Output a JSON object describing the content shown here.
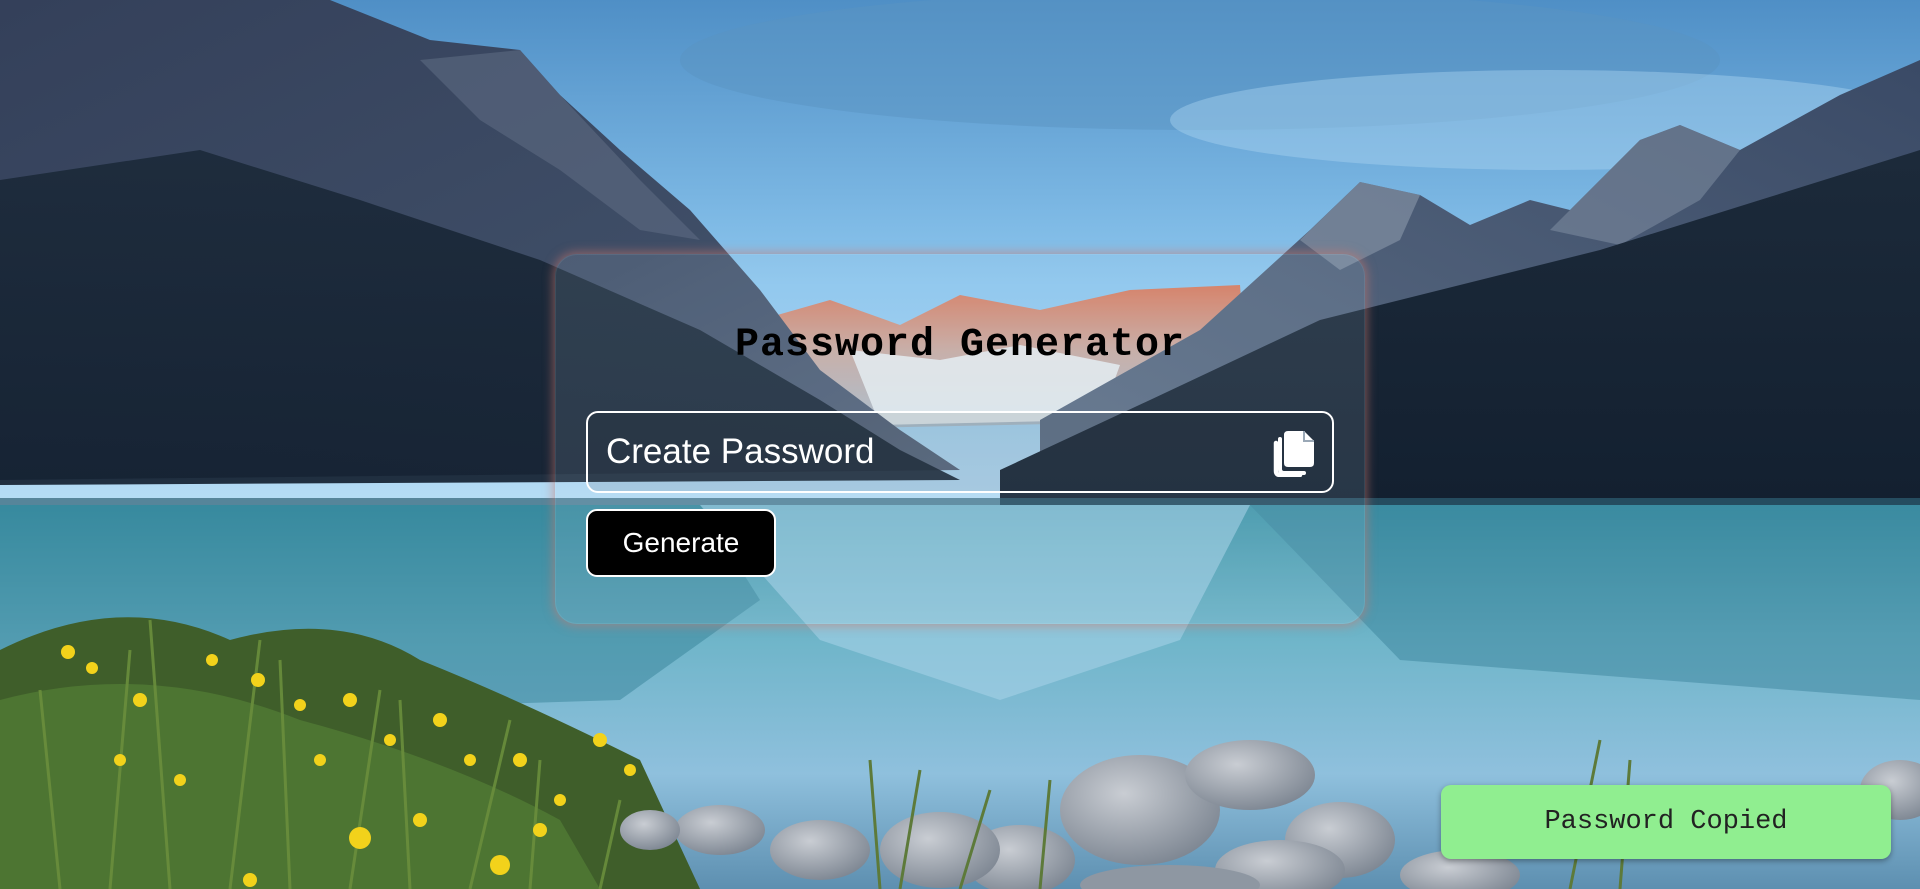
{
  "app": {
    "title": "Password Generator"
  },
  "password_field": {
    "placeholder": "Create Password",
    "value": ""
  },
  "actions": {
    "copy_icon": "copy-icon",
    "generate_label": "Generate"
  },
  "toast": {
    "message": "Password Copied",
    "color": "#90ee90"
  },
  "theme": {
    "card_glow": "#cd786e",
    "button_bg": "#000000",
    "button_text": "#ffffff"
  }
}
